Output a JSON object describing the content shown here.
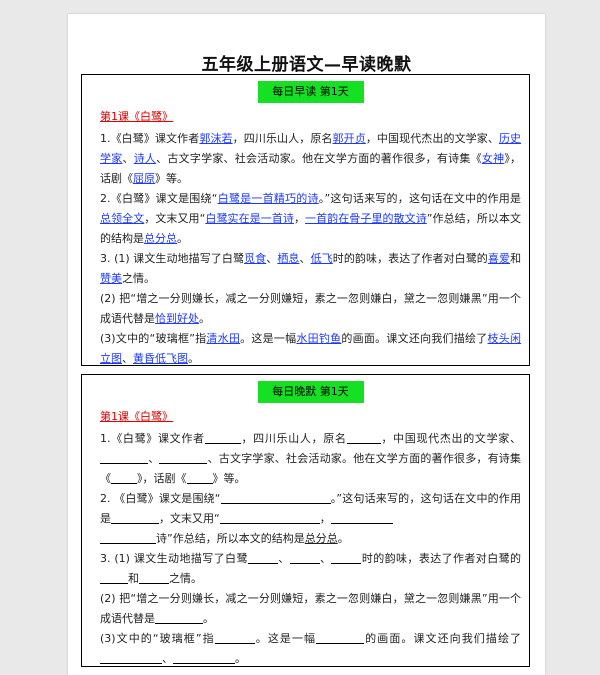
{
  "title": "五年级上册语文—早读晚默",
  "morning": {
    "header": "每日早读  第1天",
    "lesson": "第1课《白鹭》",
    "p1": {
      "t1": "1.《白鹭》课文作者",
      "a1": "郭沫若",
      "t2": "，四川乐山人，原名",
      "a2": "郭开贞",
      "t3": "，中国现代杰出的文学家、",
      "a3": "历史学家",
      "t4": "、",
      "a4": "诗人",
      "t5": "、古文字学家、社会活动家。他在文学方面的著作很多，有诗集《",
      "a5": "女神",
      "t6": "》，话剧《",
      "a6": "屈原",
      "t7": "》等。"
    },
    "p2": {
      "t1": "2.《白鹭》课文是围绕“",
      "a1": "白鹭是一首精巧的诗",
      "t2": "。”这句话来写的，这句话在文中的作用是",
      "a2": "总领全文",
      "t3": "，文末又用“",
      "a3": "白鹭实在是一首诗",
      "t4": "，",
      "a4": "一首韵在骨子里的散文诗",
      "t5": "”作总结，所以本文的结构是",
      "a5": "总分总",
      "t6": "。"
    },
    "p3": {
      "t1": "3. (1) 课文生动地描写了白鹭",
      "a1": "觅食",
      "t2": "、",
      "a2": "栖息",
      "t3": "、",
      "a3": "低飞",
      "t4": "时的韵味，表达了作者对白鹭的",
      "a4": "喜爱",
      "t5": "和",
      "a5": "赞美",
      "t6": "之情。"
    },
    "p4": {
      "t1": "(2) 把“增之一分则嫌长，减之一分则嫌短，素之一忽则嫌白，黛之一忽则嫌黑”用一个成语代替是",
      "a1": "恰到好处",
      "t2": "。"
    },
    "p5": {
      "t1": "(3)文中的“玻璃框”指",
      "a1": "清水田",
      "t2": "。这是一幅",
      "a2": "水田钓鱼",
      "t3": "的画面。课文还向我们描绘了",
      "a3": "枝头闲立图",
      "t4": "、",
      "a4": "黄昏低飞图",
      "t5": "。"
    }
  },
  "evening": {
    "header": "每日晚默  第1天",
    "lesson": "第1课《白鹭》",
    "p1": {
      "t1": "1.《白鹭》课文作者",
      "t2": "，四川乐山人，原名",
      "t3": "，中国现代杰出的文学家、",
      "t4": "、",
      "t5": "、古文字学家、社会活动家。他在文学方面的著作很多，有诗集《",
      "t6": "》，话剧《",
      "t7": "》等。"
    },
    "p2": {
      "t1": "2. 《白鹭》课文是围绕“",
      "t2": "。”这句话来写的，这句话在文中的作用是",
      "t3": "，文末又用“",
      "t4": "，",
      "t5": "诗”作总结，所以本文的结构是",
      "a1": "总分总",
      "t6": "。"
    },
    "p3": {
      "t1": "3. (1) 课文生动地描写了白鹭",
      "t2": "、",
      "t3": "、",
      "t4": "时的韵味，表达了作者对白鹭的",
      "t5": "和",
      "t6": "之情。"
    },
    "p4": {
      "t1": "(2) 把“增之一分则嫌长，减之一分则嫌短，素之一忽则嫌白，黛之一忽则嫌黑”用一个成语代替是",
      "t2": "。"
    },
    "p5": {
      "t1": "(3)文中的“玻璃框”指",
      "t2": "。这是一幅",
      "t3": "的画面。课文还向我们描绘了",
      "t4": "、",
      "t5": "。"
    }
  }
}
